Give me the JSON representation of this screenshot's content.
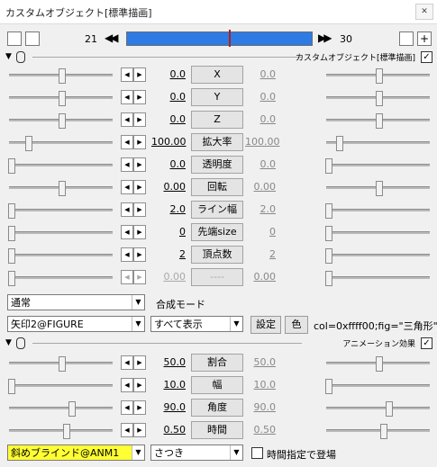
{
  "window": {
    "title": "カスタムオブジェクト[標準描画]",
    "close": "✕"
  },
  "toolbar": {
    "frame_start": "21",
    "frame_end": "30",
    "seek_back": "◀◀",
    "seek_fwd": "▶▶",
    "timeline_position": 0.55
  },
  "object_section": {
    "title": "カスタムオブジェクト[標準描画]",
    "checked": true
  },
  "params": [
    {
      "label": "X",
      "value": "0.0",
      "value2": "0.0",
      "left_pos": 0.5,
      "right_pos": 0.5,
      "disabled": false
    },
    {
      "label": "Y",
      "value": "0.0",
      "value2": "0.0",
      "left_pos": 0.5,
      "right_pos": 0.5,
      "disabled": false
    },
    {
      "label": "Z",
      "value": "0.0",
      "value2": "0.0",
      "left_pos": 0.5,
      "right_pos": 0.5,
      "disabled": false
    },
    {
      "label": "拡大率",
      "value": "100.00",
      "value2": "100.00",
      "left_pos": 0.18,
      "right_pos": 0.12,
      "disabled": false
    },
    {
      "label": "透明度",
      "value": "0.0",
      "value2": "0.0",
      "left_pos": 0.02,
      "right_pos": 0.02,
      "disabled": false
    },
    {
      "label": "回転",
      "value": "0.00",
      "value2": "0.00",
      "left_pos": 0.5,
      "right_pos": 0.5,
      "disabled": false
    },
    {
      "label": "ライン幅",
      "value": "2.0",
      "value2": "2.0",
      "left_pos": 0.02,
      "right_pos": 0.02,
      "disabled": false
    },
    {
      "label": "先端size",
      "value": "0",
      "value2": "0",
      "left_pos": 0.02,
      "right_pos": 0.02,
      "disabled": false
    },
    {
      "label": "頂点数",
      "value": "2",
      "value2": "2",
      "left_pos": 0.02,
      "right_pos": 0.02,
      "disabled": false
    },
    {
      "label": "----",
      "value": "0.00",
      "value2": "0.00",
      "left_pos": 0.02,
      "right_pos": 0.02,
      "disabled": true
    }
  ],
  "blend": {
    "value": "通常",
    "label": "合成モード"
  },
  "figure": {
    "object": "矢印2@FIGURE",
    "display": "すべて表示",
    "settings_btn": "設定",
    "color_btn": "色",
    "param_text": "col=0xffff00;fig=\"三角形\""
  },
  "anim_section": {
    "title": "アニメーション効果",
    "checked": true
  },
  "anim_params": [
    {
      "label": "割合",
      "value": "50.0",
      "value2": "50.0",
      "left_pos": 0.5,
      "right_pos": 0.5
    },
    {
      "label": "幅",
      "value": "10.0",
      "value2": "10.0",
      "left_pos": 0.02,
      "right_pos": 0.02
    },
    {
      "label": "角度",
      "value": "90.0",
      "value2": "90.0",
      "left_pos": 0.6,
      "right_pos": 0.6
    },
    {
      "label": "時間",
      "value": "0.50",
      "value2": "0.50",
      "left_pos": 0.55,
      "right_pos": 0.55
    }
  ],
  "anim_bottom": {
    "effect": "斜めブラインド@ANM1",
    "mode": "さつき",
    "time_checkbox_label": "時間指定で登場",
    "time_checked": false
  },
  "colors": {
    "timeline": "#2e7be4",
    "highlight": "#ffff33"
  }
}
